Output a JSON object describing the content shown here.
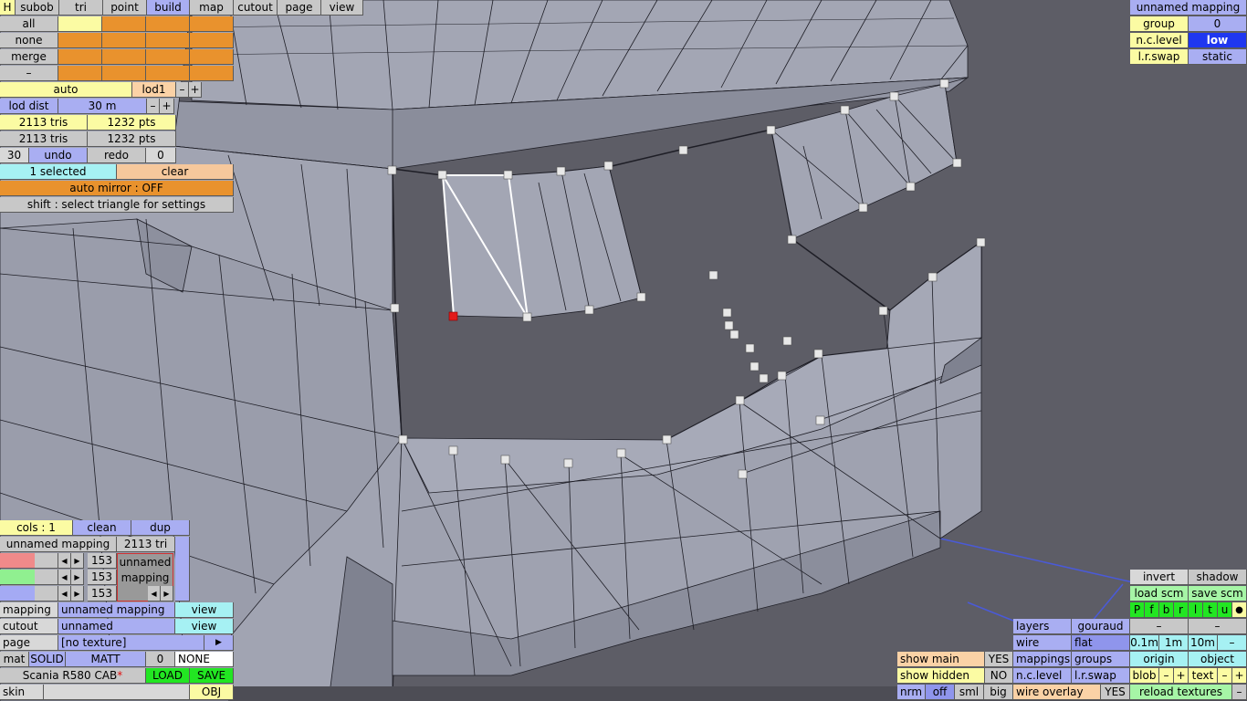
{
  "topbar": {
    "h": "H",
    "tabs": [
      "subob",
      "tri",
      "point",
      "build",
      "map",
      "cutout",
      "page",
      "view"
    ],
    "active_tab": "build"
  },
  "select": {
    "all": "all",
    "none": "none",
    "merge": "merge",
    "minus": "–"
  },
  "lod": {
    "auto": "auto",
    "lod1": "lod1",
    "minus": "–",
    "plus": "+",
    "dist_label": "lod dist",
    "dist_value": "30 m",
    "tris1": "2113 tris",
    "pts1": "1232 pts",
    "tris2": "2113 tris",
    "pts2": "1232 pts",
    "undo_count": "30",
    "undo": "undo",
    "redo": "redo",
    "redo_count": "0",
    "selected": "1 selected",
    "clear": "clear",
    "auto_mirror": "auto mirror : OFF",
    "hint": "shift : select triangle for settings"
  },
  "mapping_top": {
    "title": "unnamed mapping",
    "group_label": "group",
    "group_value": "0",
    "nclevel_label": "n.c.level",
    "nclevel_value": "low",
    "lrswap_label": "l.r.swap",
    "lrswap_value": "static"
  },
  "cols_panel": {
    "cols": "cols : 1",
    "clean": "clean",
    "dup": "dup",
    "mapping_name": "unnamed mapping",
    "tri_count": "2113 tri",
    "r_value": "153",
    "g_value": "153",
    "b_value": "153",
    "preview_text": "unnamed mapping"
  },
  "props": {
    "mapping_label": "mapping",
    "mapping_value": "unnamed mapping",
    "mapping_view": "view",
    "cutout_label": "cutout",
    "cutout_value": "unnamed",
    "cutout_view": "view",
    "page_label": "page",
    "page_value": "[no texture]",
    "page_arrow": "▶",
    "mat": "mat",
    "solid": "SOLID",
    "matt": "MATT",
    "mat_num": "0",
    "none": "NONE",
    "model_name": "Scania R580 CAB",
    "model_mark": "*",
    "load": "LOAD",
    "save": "SAVE",
    "skin": "skin",
    "obj": "OBJ"
  },
  "bottom_mid": {
    "show_main": "show main",
    "show_main_v": "YES",
    "show_hidden": "show hidden",
    "show_hidden_v": "NO",
    "nrm": "nrm",
    "off": "off",
    "sml": "sml",
    "big": "big"
  },
  "bottom_right": {
    "layers": "layers",
    "gouraud": "gouraud",
    "wire": "wire",
    "flat": "flat",
    "mappings": "mappings",
    "groups": "groups",
    "nclevel": "n.c.level",
    "lrswap": "l.r.swap",
    "wire_overlay": "wire overlay",
    "wire_overlay_v": "YES",
    "invert": "invert",
    "shadow": "shadow",
    "load_scm": "load scm",
    "save_scm": "save scm",
    "view_letters": [
      "P",
      "f",
      "b",
      "r",
      "l",
      "t",
      "u",
      "●"
    ],
    "minus1": "–",
    "minus2": "–",
    "d01": "0.1m",
    "d1": "1m",
    "d10": "10m",
    "dminus": "–",
    "origin": "origin",
    "object": "object",
    "blob": "blob",
    "blob_minus": "–",
    "blob_plus": "+",
    "text": "text",
    "text_minus": "–",
    "text_plus": "+",
    "reload": "reload textures",
    "reload_minus": "–"
  },
  "colors": {
    "viewport_bg": "#5d5d66",
    "mesh_face": "#9fa2b0",
    "selection": "#ffffff",
    "active_vertex": "#e21a1a",
    "grid": "#4a5ad8"
  }
}
